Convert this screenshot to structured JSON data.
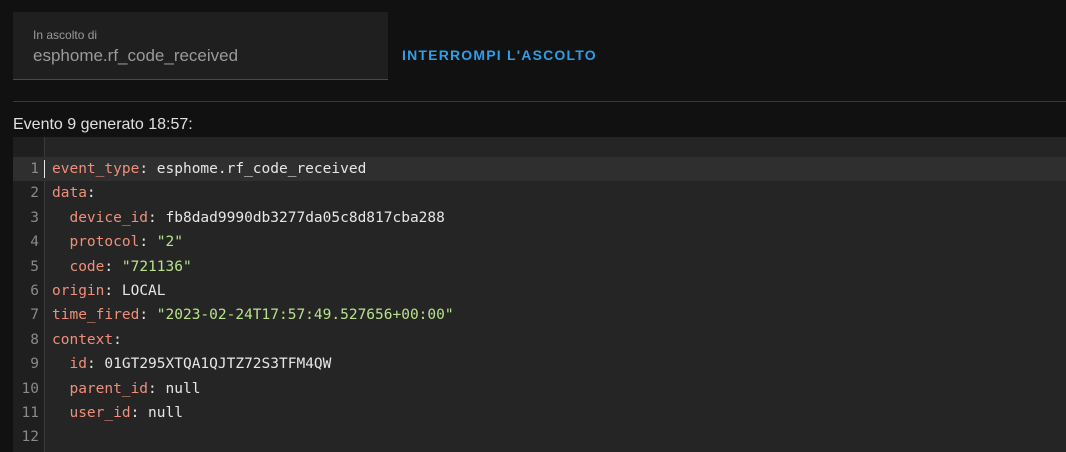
{
  "listener": {
    "label": "In ascolto di",
    "value": "esphome.rf_code_received"
  },
  "stop_button": {
    "label": "INTERROMPI L'ASCOLTO"
  },
  "event": {
    "heading": "Evento 9 generato 18:57:"
  },
  "code": {
    "lines": [
      {
        "n": "1",
        "indent": "",
        "key": "event_type",
        "value": "esphome.rf_code_received",
        "kind": "plain"
      },
      {
        "n": "2",
        "indent": "",
        "key": "data",
        "value": "",
        "kind": "plain"
      },
      {
        "n": "3",
        "indent": "  ",
        "key": "device_id",
        "value": "fb8dad9990db3277da05c8d817cba288",
        "kind": "plain"
      },
      {
        "n": "4",
        "indent": "  ",
        "key": "protocol",
        "value": "\"2\"",
        "kind": "string"
      },
      {
        "n": "5",
        "indent": "  ",
        "key": "code",
        "value": "\"721136\"",
        "kind": "string"
      },
      {
        "n": "6",
        "indent": "",
        "key": "origin",
        "value": "LOCAL",
        "kind": "plain"
      },
      {
        "n": "7",
        "indent": "",
        "key": "time_fired",
        "value": "\"2023-02-24T17:57:49.527656+00:00\"",
        "kind": "string"
      },
      {
        "n": "8",
        "indent": "",
        "key": "context",
        "value": "",
        "kind": "plain"
      },
      {
        "n": "9",
        "indent": "  ",
        "key": "id",
        "value": "01GT295XTQA1QJTZ72S3TFM4QW",
        "kind": "plain"
      },
      {
        "n": "10",
        "indent": "  ",
        "key": "parent_id",
        "value": "null",
        "kind": "plain"
      },
      {
        "n": "11",
        "indent": "  ",
        "key": "user_id",
        "value": "null",
        "kind": "plain"
      },
      {
        "n": "12",
        "indent": "",
        "key": "",
        "value": "",
        "kind": "plain"
      }
    ]
  },
  "colors": {
    "background": "#111111",
    "accent": "#2f9ee8",
    "yaml_key": "#ef8f7a",
    "yaml_string": "#b9e28c",
    "yaml_value": "#e6e6e6"
  }
}
